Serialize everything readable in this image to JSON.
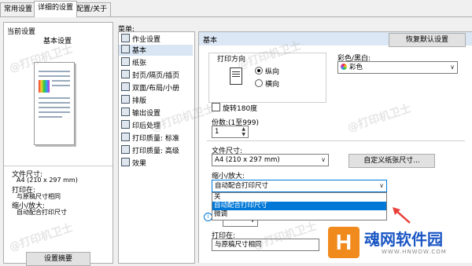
{
  "tabs": [
    "常用设置",
    "详细的设置",
    "配置/关于"
  ],
  "left": {
    "current_label": "当前设置",
    "setting_name": "基本设置",
    "info": [
      {
        "label": "文件尺寸:",
        "value": "A4 (210 x 297 mm)"
      },
      {
        "label": "打印在:",
        "value": "与原稿尺寸相同"
      },
      {
        "label": "缩小/放大:",
        "value": "自动配合打印尺寸"
      }
    ],
    "summary_button": "设置摘要"
  },
  "menu": {
    "title": "菜单:",
    "items": [
      "作业设置",
      "基本",
      "纸张",
      "封页/隔页/插页",
      "双面/布局/小册",
      "排版",
      "输出设置",
      "印后处理",
      "打印质量: 标准",
      "打印质量: 高级",
      "效果"
    ],
    "selected": 1
  },
  "main": {
    "header": "基本",
    "restore_button": "恢复默认设置",
    "orientation": {
      "label": "打印方向",
      "options": [
        "纵向",
        "横向"
      ],
      "selected": 0
    },
    "color": {
      "label": "彩色/黑白:",
      "value": "彩色"
    },
    "rotate_label": "旋转180度",
    "copies": {
      "label": "份数:(1至999)",
      "value": "1"
    },
    "paper_size": {
      "label": "文件尺寸:",
      "value": "A4 (210 x 297 mm)"
    },
    "custom_size_button": "自定义纸张尺寸...",
    "zoom": {
      "label": "缩小/放大:",
      "value": "自动配合打印尺寸",
      "options": [
        "关",
        "自动配合打印尺寸",
        "微调"
      ],
      "highlighted": 1
    },
    "print_on": {
      "label": "打印在:",
      "value": "与原稿尺寸相同"
    }
  },
  "watermarks": [
    "@打印机卫士",
    "@打印机卫士",
    "@打印机卫士",
    "@打印机卫士",
    "@打印机卫士",
    "@打印机卫士"
  ],
  "logo": {
    "text": "魂网软件园",
    "url": "WWW.HNWDW.COM"
  },
  "colors": {
    "accent": "#0078d7",
    "arrow": "#e8413a",
    "logo_orange": "#f08a1c"
  }
}
